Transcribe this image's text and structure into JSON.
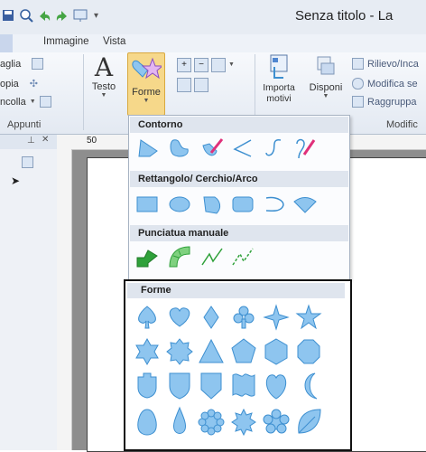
{
  "window": {
    "title": "Senza titolo - La"
  },
  "colors": {
    "shape_fill": "#8ec5ef",
    "shape_stroke": "#3d8fd0",
    "green": "#2fa13a",
    "pen": "#e0307a"
  },
  "tabs": [
    "Immagine",
    "Vista"
  ],
  "ribbon": {
    "appunti": {
      "label": "Appunti",
      "items": [
        "aglia",
        "opia",
        "ncolla"
      ]
    },
    "testo_label": "Testo",
    "forme_label": "Forme",
    "importa_label": "Importa motivi",
    "disponi_label": "Disponi",
    "modifica": {
      "label": "Modific",
      "items": [
        "Rilievo/Inca",
        "Modifica se",
        "Raggruppa"
      ]
    }
  },
  "ruler": {
    "mark": "50"
  },
  "gallery": {
    "sections": [
      {
        "title": "Contorno",
        "items": [
          "outline-polygon",
          "outline-blob",
          "outline-pen-filled",
          "outline-zigzag",
          "outline-curve",
          "outline-pen"
        ]
      },
      {
        "title": "Rettangolo/ Cerchio/Arco",
        "items": [
          "rectangle",
          "ellipse",
          "fan-shape",
          "rounded-rectangle",
          "arc",
          "sector"
        ]
      },
      {
        "title": "Punciatua manuale",
        "items": [
          "manual-green-filled",
          "manual-green-striped",
          "manual-line",
          "manual-dashed"
        ]
      }
    ],
    "forme": {
      "title": "Forme",
      "rows": [
        [
          "spade",
          "heart",
          "diamond",
          "club",
          "star-4",
          "star-5"
        ],
        [
          "star-6",
          "star-8",
          "triangle",
          "pentagon",
          "hexagon",
          "octagon"
        ],
        [
          "shield-notched",
          "shield",
          "badge",
          "banner",
          "heart-round",
          "crescent"
        ],
        [
          "egg",
          "drop",
          "scallop-8",
          "burst",
          "flower",
          "leaf"
        ]
      ]
    }
  }
}
